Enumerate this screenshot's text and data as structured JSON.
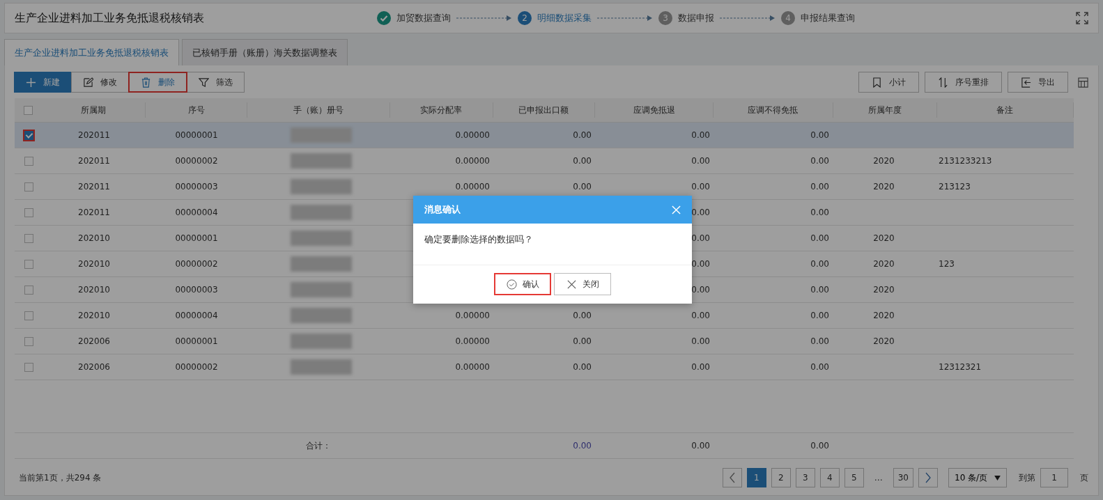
{
  "header": {
    "title": "生产企业进料加工业务免抵退税核销表",
    "steps": [
      {
        "label": "加贸数据查询",
        "done": true,
        "active": false
      },
      {
        "number": "2",
        "label": "明细数据采集",
        "done": false,
        "active": true
      },
      {
        "number": "3",
        "label": "数据申报",
        "done": false,
        "active": false
      },
      {
        "number": "4",
        "label": "申报结果查询",
        "done": false,
        "active": false
      }
    ]
  },
  "tabs": [
    {
      "label": "生产企业进料加工业务免抵退税核销表",
      "selected": true
    },
    {
      "label": "已核销手册（账册）海关数据调整表",
      "selected": false
    }
  ],
  "toolbar": {
    "left": [
      {
        "label": "新建",
        "primary": true,
        "highlighted": false
      },
      {
        "label": "修改",
        "primary": false,
        "highlighted": false
      },
      {
        "label": "删除",
        "primary": false,
        "highlighted": true
      },
      {
        "label": "筛选",
        "primary": false,
        "highlighted": false
      }
    ],
    "right": [
      {
        "label": "小计"
      },
      {
        "label": "序号重排"
      },
      {
        "label": "导出"
      }
    ]
  },
  "table": {
    "select_all": {
      "checked": false
    },
    "columns": [
      "所属期",
      "序号",
      "手（账）册号",
      "实际分配率",
      "已申报出口额",
      "应调免抵退",
      "应调不得免抵",
      "所属年度",
      "备注"
    ],
    "rows": [
      {
        "selected": true,
        "highlighted": true,
        "cells": [
          "202011",
          "00000001",
          null,
          "0.00000",
          "0.00",
          "0.00",
          "0.00",
          null,
          null
        ]
      },
      {
        "selected": false,
        "highlighted": false,
        "cells": [
          "202011",
          "00000002",
          null,
          "0.00000",
          "0.00",
          "0.00",
          "0.00",
          "2020",
          "2131233213"
        ]
      },
      {
        "selected": false,
        "highlighted": false,
        "cells": [
          "202011",
          "00000003",
          null,
          "0.00000",
          "0.00",
          "0.00",
          "0.00",
          "2020",
          "213123"
        ]
      },
      {
        "selected": false,
        "highlighted": false,
        "cells": [
          "202011",
          "00000004",
          null,
          null,
          null,
          "0.00",
          "0.00",
          null,
          null
        ]
      },
      {
        "selected": false,
        "highlighted": false,
        "cells": [
          "202010",
          "00000001",
          null,
          null,
          null,
          "0.00",
          "0.00",
          "2020",
          null
        ]
      },
      {
        "selected": false,
        "highlighted": false,
        "cells": [
          "202010",
          "00000002",
          null,
          null,
          null,
          "0.00",
          "0.00",
          "2020",
          "123"
        ]
      },
      {
        "selected": false,
        "highlighted": false,
        "cells": [
          "202010",
          "00000003",
          null,
          null,
          null,
          "0.00",
          "0.00",
          "2020",
          null
        ]
      },
      {
        "selected": false,
        "highlighted": false,
        "cells": [
          "202010",
          "00000004",
          null,
          "0.00000",
          "0.00",
          "0.00",
          "0.00",
          "2020",
          null
        ]
      },
      {
        "selected": false,
        "highlighted": false,
        "cells": [
          "202006",
          "00000001",
          null,
          "0.00000",
          "0.00",
          "0.00",
          "0.00",
          "2020",
          null
        ]
      },
      {
        "selected": false,
        "highlighted": false,
        "cells": [
          "202006",
          "00000002",
          null,
          "0.00000",
          "0.00",
          "0.00",
          "0.00",
          null,
          "12312321"
        ]
      }
    ],
    "totals": {
      "label": "合计：",
      "cells": [
        null,
        null,
        null,
        null,
        "0.00",
        "0.00",
        "0.00",
        null,
        null
      ]
    }
  },
  "footer": {
    "summary": "当前第1页，共294 条",
    "pages": [
      {
        "label": "1",
        "selected": true
      },
      {
        "label": "2",
        "selected": false
      },
      {
        "label": "3",
        "selected": false
      },
      {
        "label": "4",
        "selected": false
      },
      {
        "label": "5",
        "selected": false
      }
    ],
    "ellipsis": "…",
    "last_page": {
      "label": "30",
      "selected": false
    },
    "page_size": "10 条/页",
    "goto_label": "到第",
    "goto_value": "1",
    "page_unit": "页"
  },
  "dialog": {
    "title": "消息确认",
    "message": "确定要删除选择的数据吗？",
    "buttons": [
      {
        "label": "确认",
        "highlighted": true
      },
      {
        "label": "关闭",
        "highlighted": false
      }
    ]
  }
}
